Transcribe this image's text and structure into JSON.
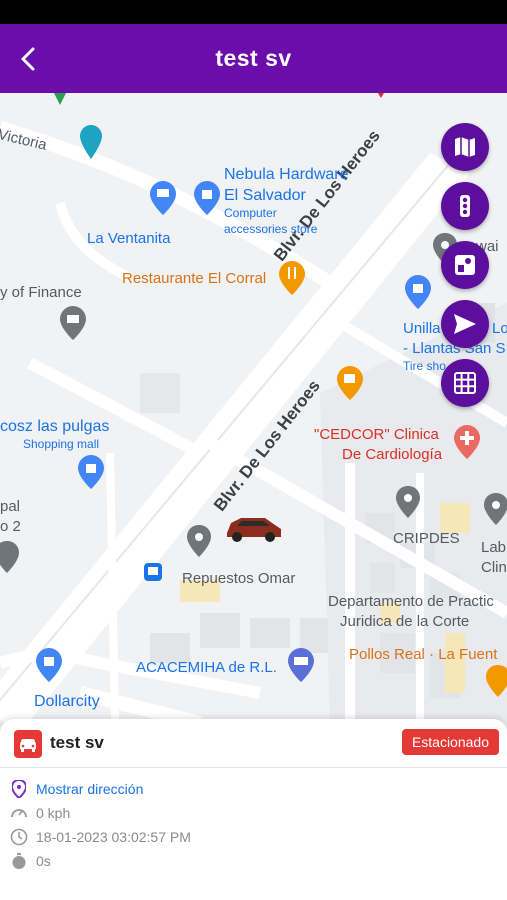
{
  "app": {
    "title": "test sv"
  },
  "map": {
    "roads": {
      "road1": "Blvr. De Los Heroes",
      "road2": "Blvr. De Los Heroes",
      "victoria": "Victoria"
    },
    "places": {
      "nebula_line1": "Nebula Hardware",
      "nebula_line2": "El Salvador",
      "nebula_sub1": "Computer",
      "nebula_sub2": "accessories store",
      "ventanita": "La Ventanita",
      "corral": "Restaurante El Corral",
      "finance": "y of Finance",
      "pulgas": "cosz las pulgas",
      "pulgas_sub": "Shopping mall",
      "cedcor1": "\"CEDCOR\" Clinica",
      "cedcor2": "De Cardiología",
      "unilla1": "Unilla",
      "unilla1b": "Lo",
      "unilla2": "- Llantas San S",
      "unilla_sub": "Tire sho",
      "wai": "wai",
      "pal": "pal",
      "o2": "o 2",
      "cripdes": "CRIPDES",
      "lab1": "Lab",
      "lab2": "Clin",
      "repuestos": "Repuestos Omar",
      "departamento1": "Departamento de Practic",
      "departamento2": "Juridica de la Corte",
      "pollos": "Pollos Real · La Fuent",
      "acacemiha": "ACACEMIHA de R.L.",
      "dollarcity": "Dollarcity"
    }
  },
  "controls": [
    "map-layers-icon",
    "traffic-icon",
    "street-view-icon",
    "navigate-icon",
    "grid-icon"
  ],
  "vehicle": {
    "name": "test sv",
    "status": "Estacionado",
    "address_link": "Mostrar dirección",
    "speed": "0 kph",
    "timestamp": "18-01-2023 03:02:57 PM",
    "duration": "0s"
  },
  "colors": {
    "primary": "#6a0dab",
    "fab": "#5b0f9c",
    "status": "#e53935",
    "link": "#1a73e8"
  }
}
